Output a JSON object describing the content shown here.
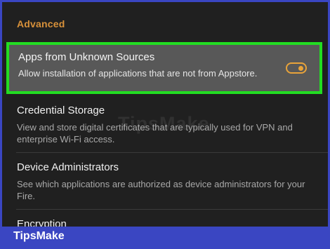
{
  "section": {
    "header": "Advanced"
  },
  "settings": [
    {
      "title": "Apps from Unknown Sources",
      "description": "Allow installation of applications that are not from Appstore.",
      "toggle_on": true
    },
    {
      "title": "Credential Storage",
      "description": "View and store digital certificates that are typically used for VPN and enterprise Wi-Fi access."
    },
    {
      "title": "Device Administrators",
      "description": "See which applications are authorized as device administrators for your Fire."
    },
    {
      "title": "Encryption"
    }
  ],
  "watermark": "TipsMake",
  "brand": "TipsMake",
  "colors": {
    "accent": "#e8a33a",
    "highlight_border": "#22dd22",
    "frame": "#3a46c2",
    "background": "#202020"
  }
}
